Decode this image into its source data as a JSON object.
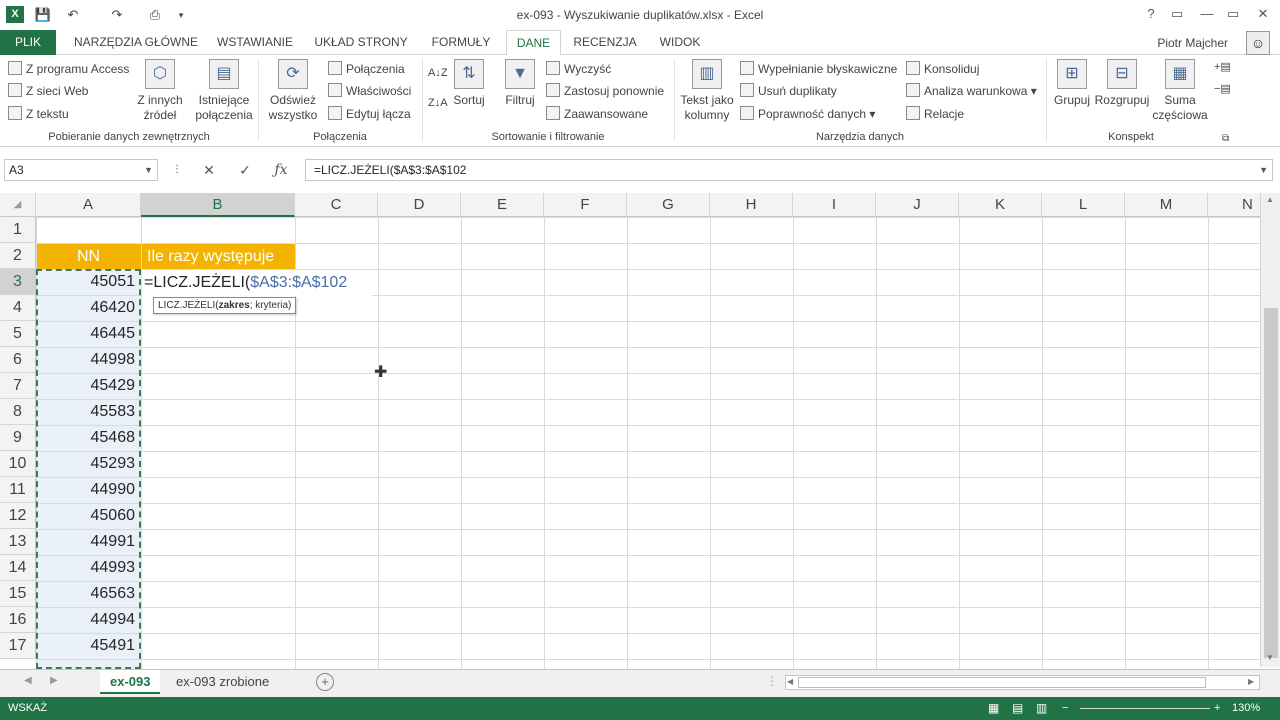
{
  "window": {
    "title": "ex-093 - Wyszukiwanie duplikatów.xlsx - Excel",
    "controls": [
      "?",
      "▭",
      "—",
      "▭",
      "✕"
    ]
  },
  "tabs": [
    "PLIK",
    "NARZĘDZIA GŁÓWNE",
    "WSTAWIANIE",
    "UKŁAD STRONY",
    "FORMUŁY",
    "DANE",
    "RECENZJA",
    "WIDOK"
  ],
  "active_tab": "DANE",
  "user": "Piotr Majcher",
  "ribbon": {
    "groups": {
      "external": "Pobieranie danych zewnętrznych",
      "connections": "Połączenia",
      "sort_filter": "Sortowanie i filtrowanie",
      "data_tools": "Narzędzia danych",
      "outline": "Konspekt"
    },
    "buttons": {
      "from_access": "Z programu Access",
      "from_web": "Z sieci Web",
      "from_text": "Z tekstu",
      "other_sources_1": "Z innych",
      "other_sources_2": "źródeł",
      "existing_1": "Istniejące",
      "existing_2": "połączenia",
      "refresh_1": "Odśwież",
      "refresh_2": "wszystko",
      "connections": "Połączenia",
      "properties": "Właściwości",
      "edit_links": "Edytuj łącza",
      "sort": "Sortuj",
      "filter": "Filtruj",
      "clear": "Wyczyść",
      "reapply": "Zastosuj ponownie",
      "advanced": "Zaawansowane",
      "text_to_columns_1": "Tekst jako",
      "text_to_columns_2": "kolumny",
      "flash_fill": "Wypełnianie błyskawiczne",
      "remove_duplicates": "Usuń duplikaty",
      "data_validation": "Poprawność danych",
      "consolidate": "Konsoliduj",
      "what_if": "Analiza warunkowa",
      "relationships": "Relacje",
      "group": "Grupuj",
      "ungroup": "Rozgrupuj",
      "subtotal_1": "Suma",
      "subtotal_2": "częściowa"
    }
  },
  "formula_bar": {
    "name_box": "A3",
    "formula": "=LICZ.JEŻELI($A$3:$A$102"
  },
  "columns": [
    "A",
    "B",
    "C",
    "D",
    "E",
    "F",
    "G",
    "H",
    "I",
    "J",
    "K",
    "L",
    "M",
    "N"
  ],
  "rows": [
    "1",
    "2",
    "3",
    "4",
    "5",
    "6",
    "7",
    "8",
    "9",
    "10",
    "11",
    "12",
    "13",
    "14",
    "15",
    "16",
    "17"
  ],
  "cells": {
    "A2": "NN",
    "B2": "Ile razy występuje",
    "B3_prefix": "=LICZ.JEŻELI(",
    "B3_range": "$A$3:$A$102",
    "tooltip_fn": "LICZ.JEŻELI(",
    "tooltip_arg1": "zakres",
    "tooltip_rest": "; kryteria)",
    "values": [
      "45051",
      "46420",
      "46445",
      "44998",
      "45429",
      "45583",
      "45468",
      "45293",
      "44990",
      "45060",
      "44991",
      "44993",
      "46563",
      "44994",
      "45491"
    ]
  },
  "sheets": [
    "ex-093",
    "ex-093 zrobione"
  ],
  "active_sheet": "ex-093",
  "status": {
    "mode": "WSKAŻ",
    "zoom": "130%"
  },
  "colors": {
    "accent": "#217346",
    "header_fill": "#f3b300",
    "range_blue": "#4a6fa5"
  }
}
